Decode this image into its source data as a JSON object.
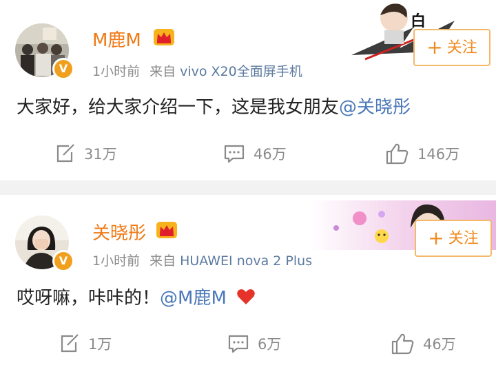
{
  "posts": [
    {
      "username": "M鹿M",
      "time": "1小时前",
      "source_prefix": "来自",
      "device": "vivo X20全面屏手机",
      "text": "大家好，给大家介绍一下，这是我女朋友",
      "mention": "@关晓彤",
      "follow_label": "关注",
      "repost_count": "31万",
      "comment_count": "46万",
      "like_count": "146万"
    },
    {
      "username": "关晓彤",
      "time": "1小时前",
      "source_prefix": "来自",
      "device": "HUAWEI nova 2 Plus",
      "text": "哎呀嘛，咔咔的！",
      "mention": "@M鹿M",
      "follow_label": "关注",
      "repost_count": "1万",
      "comment_count": "6万",
      "like_count": "46万"
    }
  ],
  "colors": {
    "username": "#f07a16",
    "mention": "#4a78b8",
    "follow_border": "#f3b86a",
    "verified_badge": "#f0a01e"
  },
  "icons": [
    "crown-icon",
    "verified-icon",
    "repost-icon",
    "comment-icon",
    "like-icon",
    "heart-emoji-icon"
  ]
}
